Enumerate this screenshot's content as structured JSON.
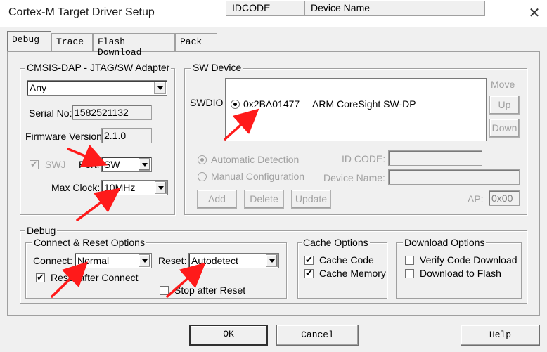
{
  "window": {
    "title": "Cortex-M Target Driver Setup"
  },
  "tabs": [
    {
      "label": "Debug",
      "active": true
    },
    {
      "label": "Trace"
    },
    {
      "label": "Flash Download"
    },
    {
      "label": "Pack"
    }
  ],
  "adapter": {
    "legend": "CMSIS-DAP - JTAG/SW Adapter",
    "selected": "Any",
    "serial_label": "Serial No:",
    "serial": "1582521132",
    "firmware_label": "Firmware Version:",
    "firmware": "2.1.0",
    "swj_label": "SWJ",
    "port_label": "Port:",
    "port": "SW",
    "max_clock_label": "Max Clock:",
    "max_clock": "10MHz"
  },
  "sw_device": {
    "legend": "SW Device",
    "swdio_label": "SWDIO",
    "columns": [
      "IDCODE",
      "Device Name"
    ],
    "rows": [
      {
        "idcode": "0x2BA01477",
        "device_name": "ARM CoreSight SW-DP"
      }
    ],
    "move_label": "Move",
    "up_label": "Up",
    "down_label": "Down",
    "auto_detect_label": "Automatic Detection",
    "manual_config_label": "Manual Configuration",
    "id_code_label": "ID CODE:",
    "device_name_label": "Device Name:",
    "add_label": "Add",
    "delete_label": "Delete",
    "update_label": "Update",
    "ap_label": "AP:",
    "ap_value": "0x00"
  },
  "debug": {
    "legend": "Debug",
    "connect_reset": {
      "legend": "Connect & Reset Options",
      "connect_label": "Connect:",
      "connect": "Normal",
      "reset_label": "Reset:",
      "reset": "Autodetect",
      "reset_after_connect_label": "Reset after Connect",
      "stop_after_reset_label": "Stop after Reset"
    },
    "cache": {
      "legend": "Cache Options",
      "code_label": "Cache Code",
      "memory_label": "Cache Memory"
    },
    "download": {
      "legend": "Download Options",
      "verify_label": "Verify Code Download",
      "flash_label": "Download to Flash"
    }
  },
  "footer": {
    "ok_label": "OK",
    "cancel_label": "Cancel",
    "help_label": "Help"
  },
  "annotation_color": "#ff1a1a"
}
